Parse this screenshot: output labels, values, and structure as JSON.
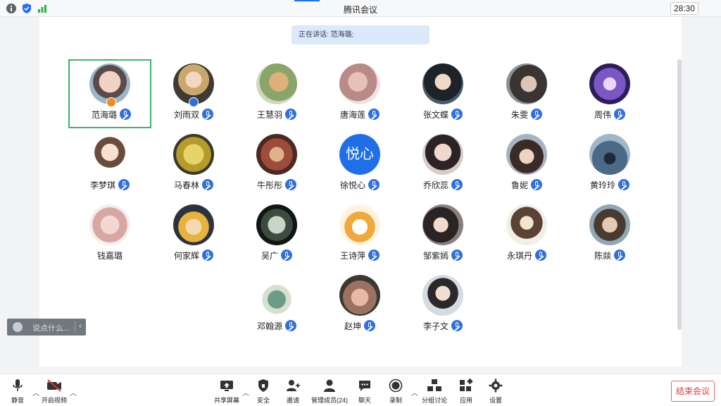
{
  "window": {
    "title": "腾讯会议",
    "timer": "28:30"
  },
  "speaking": {
    "label": "正在讲话: 范海璐;"
  },
  "participants": [
    {
      "name": "范海璐"
    },
    {
      "name": "刘雨双"
    },
    {
      "name": "王慧羽"
    },
    {
      "name": "唐海莲"
    },
    {
      "name": "张文蝶"
    },
    {
      "name": "朱雯"
    },
    {
      "name": "周伟"
    },
    {
      "name": "李梦琪"
    },
    {
      "name": "马春林"
    },
    {
      "name": "牛彤彤"
    },
    {
      "name": "徐悦心",
      "avatar_text": "悦心"
    },
    {
      "name": "乔欣蕊"
    },
    {
      "name": "鲁妮"
    },
    {
      "name": "黄玲玲"
    },
    {
      "name": "钱嘉璐"
    },
    {
      "name": "何家辉"
    },
    {
      "name": "吴广"
    },
    {
      "name": "王诗萍"
    },
    {
      "name": "邹紫嫣"
    },
    {
      "name": "永琪丹"
    },
    {
      "name": "陈燚"
    },
    {
      "name": "邓翰源"
    },
    {
      "name": "赵坤"
    },
    {
      "name": "李子文"
    }
  ],
  "chat": {
    "placeholder": "说点什么..."
  },
  "toolbar": {
    "mute": "静音",
    "video": "开启视频",
    "share": "共享屏幕",
    "security": "安全",
    "invite": "邀请",
    "members": "管理成员(24)",
    "chat": "聊天",
    "record": "录制",
    "breakout": "分组讨论",
    "apps": "应用",
    "settings": "设置",
    "end": "结束会议"
  },
  "colors": {
    "accent": "#2f6fde",
    "active_border": "#3cb371",
    "end": "#d43c3c"
  }
}
